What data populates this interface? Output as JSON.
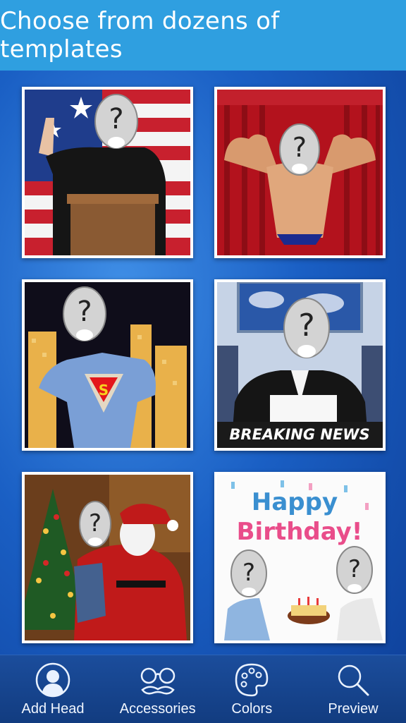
{
  "header": {
    "title": "Choose from dozens of templates"
  },
  "templates": [
    {
      "id": "politician"
    },
    {
      "id": "bodybuilder"
    },
    {
      "id": "superhero"
    },
    {
      "id": "news-anchor",
      "banner": "BREAKING NEWS"
    },
    {
      "id": "santa"
    },
    {
      "id": "birthday",
      "greeting_line1": "Happy",
      "greeting_line2": "Birthday!"
    }
  ],
  "tabbar": {
    "tabs": [
      {
        "label": "Add Head",
        "icon": "head-icon"
      },
      {
        "label": "Accessories",
        "icon": "glasses-mustache-icon"
      },
      {
        "label": "Colors",
        "icon": "palette-icon"
      },
      {
        "label": "Preview",
        "icon": "magnifier-icon"
      }
    ]
  },
  "colors": {
    "header": "#2f9fe0",
    "tabbar": "#1b4d9c",
    "tile_border": "#ffffff"
  }
}
